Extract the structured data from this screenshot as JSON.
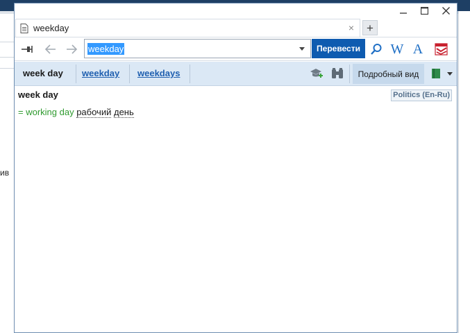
{
  "background": {
    "left_fragment": "ив"
  },
  "window": {
    "controls": [
      "minimize-icon",
      "maximize-icon",
      "close-icon"
    ]
  },
  "tabs": [
    {
      "title": "weekday",
      "icon": "document-icon"
    }
  ],
  "tab_actions": {
    "close": "×",
    "add": "+"
  },
  "toolbar": {
    "icons": [
      "pin-icon",
      "back-arrow-icon",
      "forward-arrow-icon"
    ],
    "search_value": "weekday",
    "translate_label": "Перевести",
    "services": [
      "search-icon",
      "wikipedia-icon",
      "font-icon",
      "lingvo-logo-icon"
    ],
    "w_glyph": "W",
    "a_glyph": "A"
  },
  "word_bar": {
    "current": "week day",
    "links": [
      "weekday",
      "weekdays"
    ],
    "detail_label": "Подробный вид",
    "icons": [
      "learn-card-icon",
      "binoculars-icon",
      "dictionary-book-icon"
    ]
  },
  "entry": {
    "headword": "week day",
    "dictionary": "Politics (En-Ru)",
    "synonym_prefix": "= working day",
    "translation_words": [
      "рабочий",
      "день"
    ]
  },
  "colors": {
    "accent_button": "#0e5bb0",
    "wordbar_bg": "#dbe8f5",
    "synonym": "#2f9a2f",
    "link": "#2060b0"
  }
}
